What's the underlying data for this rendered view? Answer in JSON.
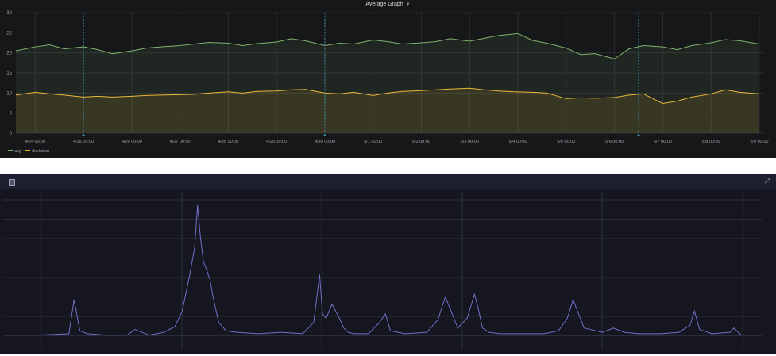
{
  "panel1": {
    "title": "Average Graph",
    "colors": {
      "background": "#161719",
      "grid": "#2a2b2e",
      "avg": "#7eb26d",
      "deviation": "#eab839",
      "marker": "#3a8ba8",
      "text": "#9fa1a6"
    }
  },
  "panel2": {
    "icons": {
      "left": "panel-menu-icon",
      "right": "expand-icon"
    },
    "colors": {
      "background": "#151620",
      "header": "#1e2030",
      "grid": "#2b2d3d",
      "line": "#6f6fc7"
    }
  },
  "chart_data": [
    {
      "type": "line",
      "title": "Average Graph",
      "xlabel": "",
      "ylabel": "",
      "ylim": [
        0,
        30
      ],
      "xlim": [
        23.6,
        39.1
      ],
      "x_ticks": [
        "4/24 00:00",
        "4/25 00:00",
        "4/26 00:00",
        "4/27 00:00",
        "4/28 00:00",
        "4/29 00:00",
        "4/30 00:00",
        "5/1 00:00",
        "5/2 00:00",
        "5/3 00:00",
        "5/4 00:00",
        "5/5 00:00",
        "5/6 00:00",
        "5/7 00:00",
        "5/8 00:00",
        "5/9 00:00"
      ],
      "y_ticks": [
        0,
        5,
        10,
        15,
        20,
        25,
        30
      ],
      "grid": true,
      "legend": "bottom-left",
      "annotations": [
        25.0,
        30.0,
        36.5
      ],
      "series": [
        {
          "name": "avg",
          "x": [
            23.6,
            24.0,
            24.3,
            24.6,
            25.0,
            25.3,
            25.6,
            26.0,
            26.3,
            26.6,
            27.0,
            27.3,
            27.6,
            28.0,
            28.3,
            28.6,
            29.0,
            29.3,
            29.6,
            30.0,
            30.3,
            30.6,
            31.0,
            31.3,
            31.6,
            32.0,
            32.3,
            32.6,
            33.0,
            33.3,
            33.6,
            34.0,
            34.3,
            34.6,
            35.0,
            35.3,
            35.6,
            36.0,
            36.3,
            36.6,
            37.0,
            37.3,
            37.6,
            38.0,
            38.3,
            38.6,
            39.0
          ],
          "y": [
            20.5,
            21.5,
            22,
            21,
            21.5,
            20.8,
            19.8,
            20.5,
            21.2,
            21.5,
            21.8,
            22.2,
            22.6,
            22.4,
            21.8,
            22.3,
            22.7,
            23.5,
            23.0,
            21.8,
            22.4,
            22.2,
            23.2,
            22.8,
            22.2,
            22.5,
            22.8,
            23.5,
            22.9,
            23.6,
            24.3,
            24.8,
            23.1,
            22.4,
            21.2,
            19.6,
            19.8,
            18.5,
            21.0,
            21.8,
            21.5,
            20.8,
            21.8,
            22.5,
            23.3,
            23.0,
            22.2
          ]
        },
        {
          "name": "deviation",
          "x": [
            23.6,
            24.0,
            24.3,
            24.6,
            25.0,
            25.3,
            25.6,
            26.0,
            26.3,
            26.6,
            27.0,
            27.3,
            27.6,
            28.0,
            28.3,
            28.6,
            29.0,
            29.3,
            29.6,
            30.0,
            30.3,
            30.6,
            31.0,
            31.3,
            31.6,
            32.0,
            32.3,
            32.6,
            33.0,
            33.3,
            33.6,
            34.0,
            34.3,
            34.6,
            35.0,
            35.3,
            35.6,
            36.0,
            36.3,
            36.6,
            37.0,
            37.3,
            37.6,
            38.0,
            38.3,
            38.6,
            39.0
          ],
          "y": [
            9.5,
            10.2,
            9.8,
            9.5,
            9.0,
            9.2,
            9.0,
            9.2,
            9.4,
            9.5,
            9.6,
            9.7,
            10.0,
            10.3,
            10.0,
            10.4,
            10.5,
            10.8,
            10.9,
            10.0,
            9.8,
            10.2,
            9.4,
            10.0,
            10.4,
            10.6,
            10.8,
            11.0,
            11.2,
            10.8,
            10.5,
            10.3,
            10.2,
            10.0,
            8.6,
            8.8,
            8.7,
            8.9,
            9.5,
            9.8,
            7.4,
            8.0,
            9.0,
            9.8,
            10.8,
            10.2,
            9.8
          ]
        }
      ]
    },
    {
      "type": "line",
      "title": "",
      "xlabel": "",
      "ylabel": "",
      "ylim": [
        0,
        100
      ],
      "xlim": [
        0,
        100
      ],
      "x_ticks": [],
      "y_ticks": [],
      "grid": true,
      "series": [
        {
          "name": "",
          "x": [
            0,
            4,
            4.7,
            5.5,
            6.5,
            9,
            12,
            13,
            15,
            17,
            18.5,
            19.5,
            20.5,
            21.2,
            21.6,
            22.0,
            22.4,
            22.8,
            23.3,
            23.8,
            24.5,
            25.5,
            27,
            30,
            33,
            36,
            37.5,
            38.3,
            38.7,
            39.2,
            40,
            41,
            41.6,
            42.2,
            43,
            45,
            46.5,
            47.3,
            48,
            50,
            53,
            54.5,
            55.5,
            56.3,
            57.2,
            58.5,
            59.5,
            60,
            60.6,
            61.5,
            63,
            66,
            69,
            71,
            72.2,
            73,
            74.5,
            77,
            78.5,
            80,
            82,
            85,
            87.5,
            89,
            89.6,
            90.3,
            92,
            94.5,
            95,
            96
          ],
          "y": [
            3,
            4,
            28,
            6,
            4,
            3,
            3,
            7,
            3,
            5,
            9,
            20,
            45,
            65,
            95,
            72,
            55,
            50,
            42,
            28,
            12,
            6,
            5,
            4,
            5,
            4,
            12,
            46,
            18,
            15,
            25,
            15,
            8,
            5,
            4,
            4,
            12,
            18,
            6,
            4,
            5,
            14,
            30,
            20,
            8,
            15,
            32,
            22,
            8,
            5,
            4,
            4,
            4,
            6,
            15,
            28,
            8,
            5,
            8,
            5,
            4,
            4,
            5,
            10,
            20,
            7,
            4,
            5,
            8,
            3
          ]
        }
      ]
    }
  ]
}
